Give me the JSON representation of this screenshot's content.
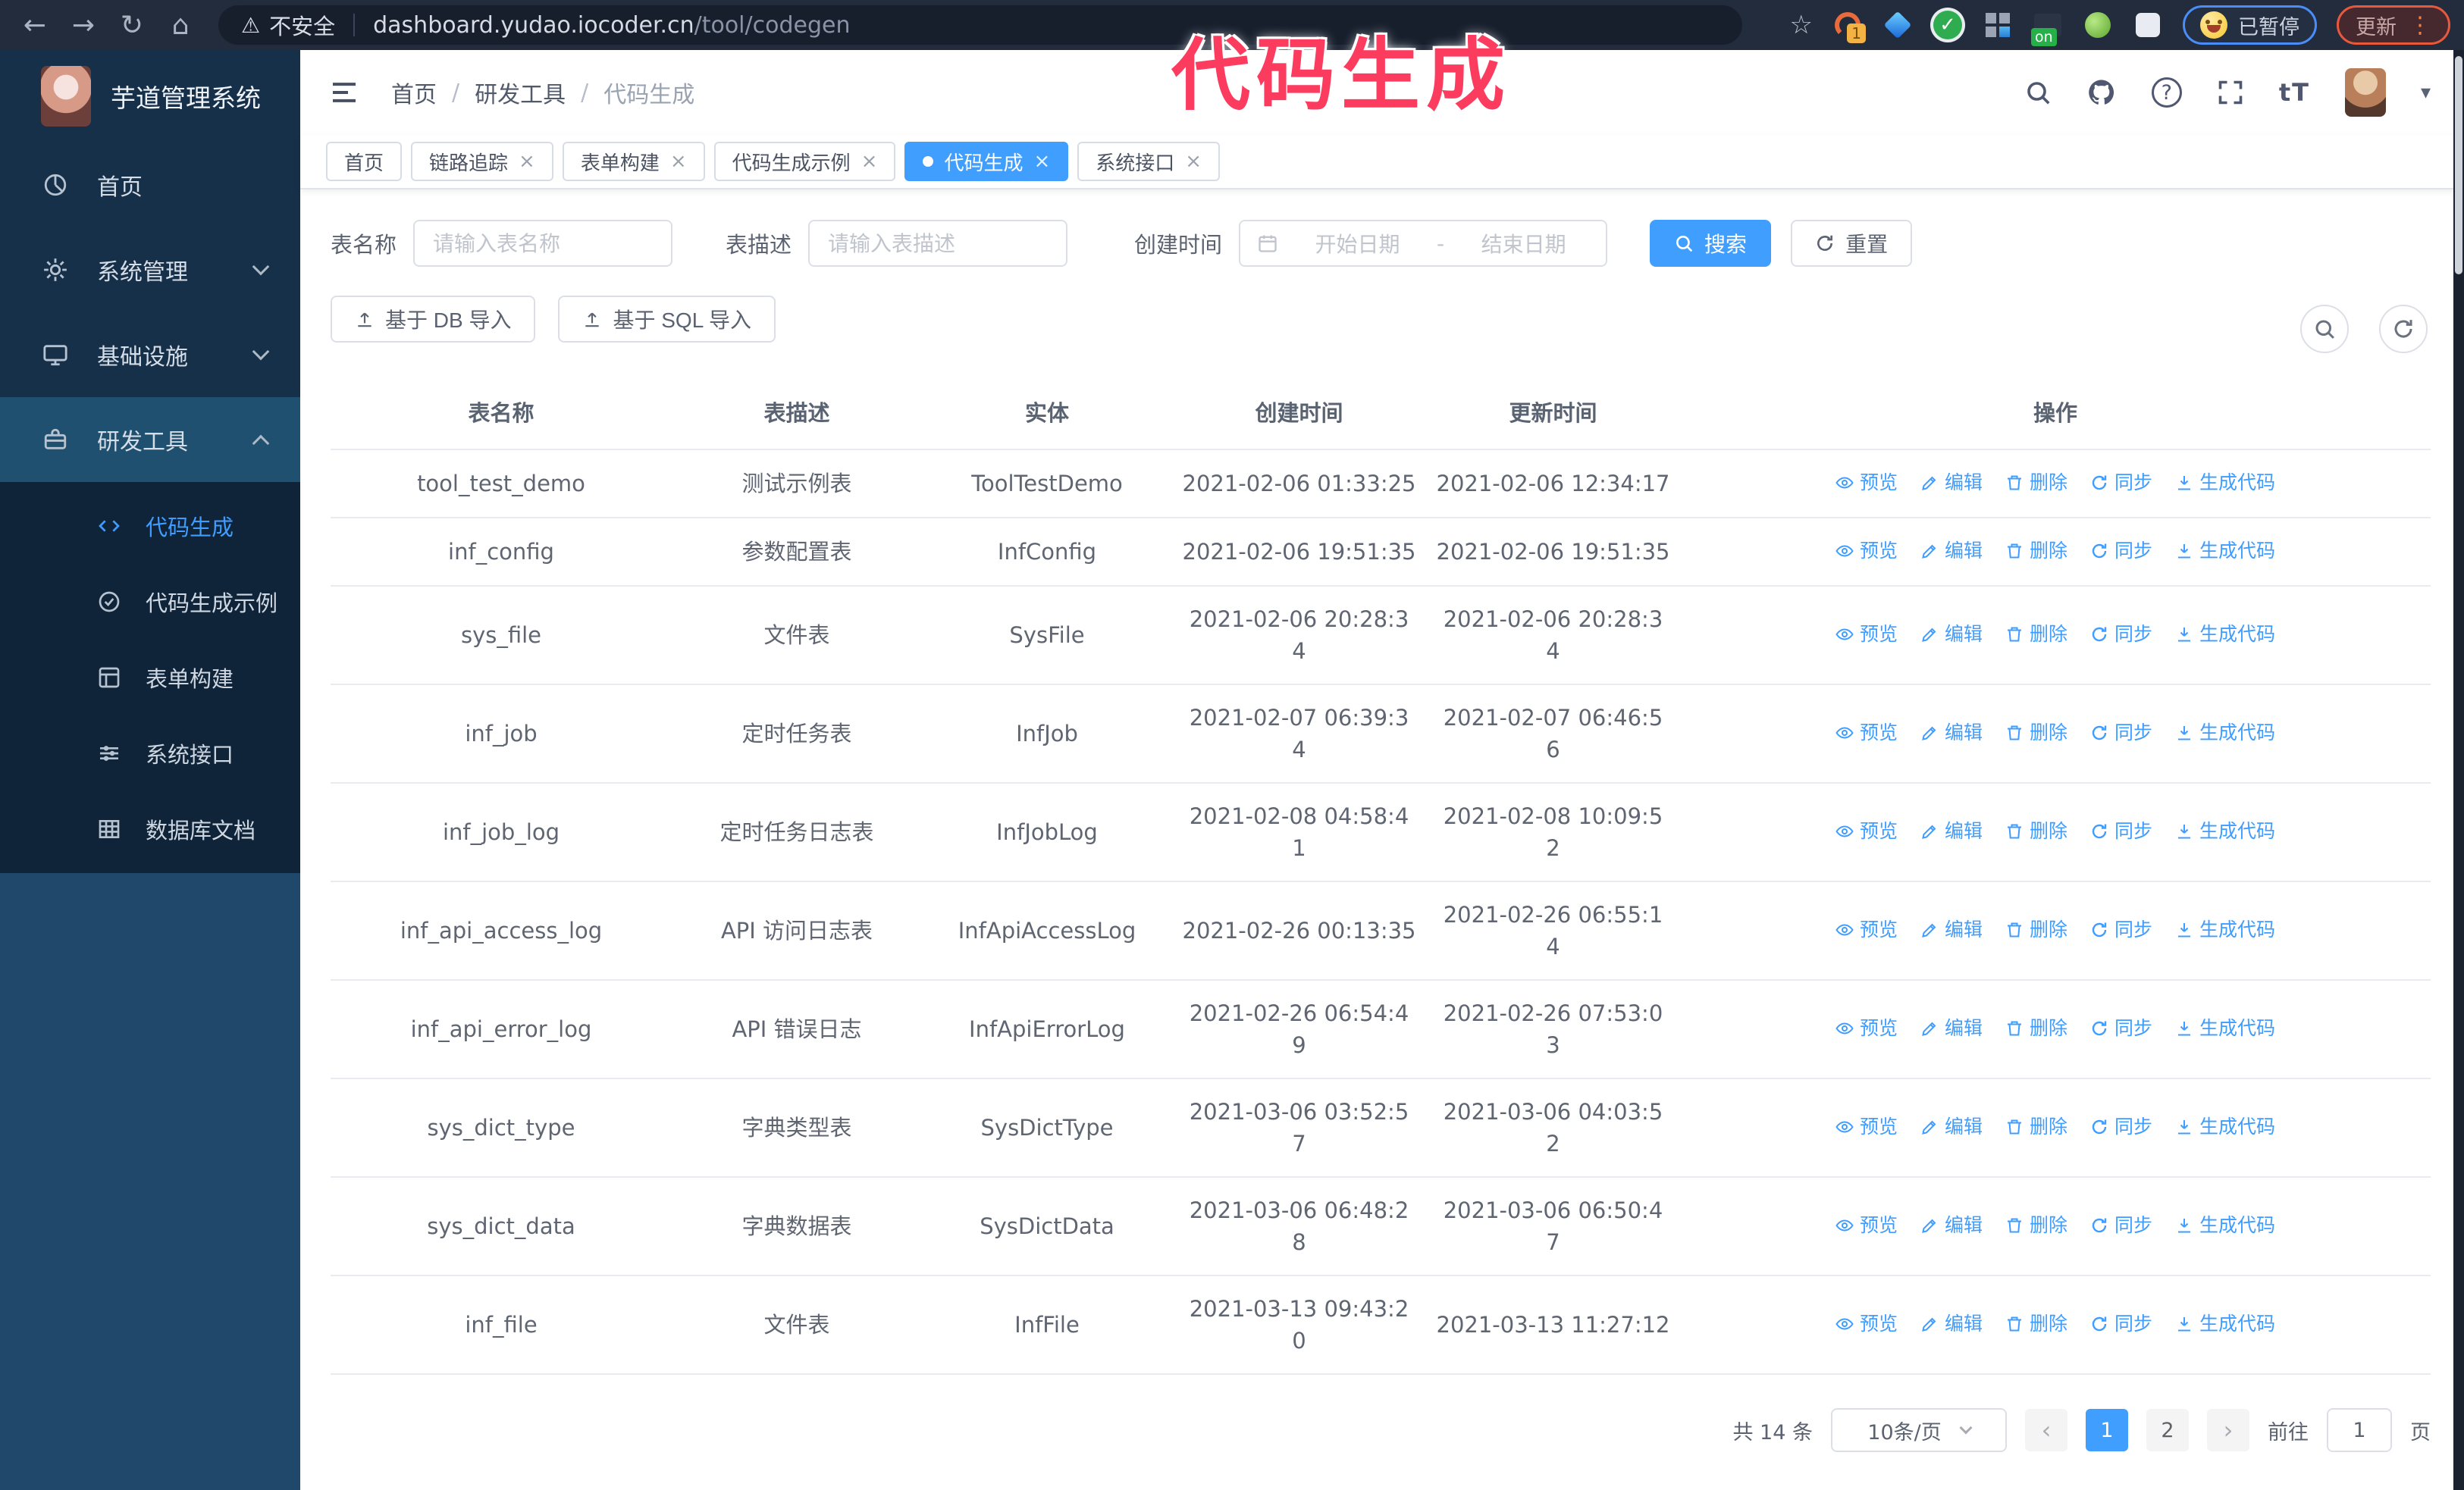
{
  "colors": {
    "accent": "#409eff",
    "annotation_pink": "#fb3c5f",
    "sidebar_bg": "#16304a",
    "submenu_bg": "#0f2438"
  },
  "icons": {
    "back": "←",
    "forward": "→",
    "reload": "↻",
    "home": "⌂",
    "warning": "⚠",
    "star": "☆",
    "check": "✓",
    "kebab": "⋮",
    "close": "×",
    "caret_down": "▾",
    "question": "?",
    "font_size": "tT",
    "prev": "‹",
    "next": "›"
  },
  "browser": {
    "security_label": "不安全",
    "url_domain": "dashboard.yudao.iocoder.cn",
    "url_path": "/tool/codegen",
    "ext_badge_1": "1",
    "ext_on_badge": "on",
    "paused_label": "已暂停",
    "update_label": "更新"
  },
  "annotation": {
    "text": "代码生成"
  },
  "sidebar": {
    "app_title": "芋道管理系统",
    "items": [
      {
        "label": "首页"
      },
      {
        "label": "系统管理"
      },
      {
        "label": "基础设施"
      },
      {
        "label": "研发工具"
      }
    ],
    "submenu": [
      {
        "label": "代码生成"
      },
      {
        "label": "代码生成示例"
      },
      {
        "label": "表单构建"
      },
      {
        "label": "系统接口"
      },
      {
        "label": "数据库文档"
      }
    ]
  },
  "header": {
    "breadcrumb": [
      "首页",
      "研发工具",
      "代码生成"
    ],
    "separator": "/"
  },
  "tabs": [
    {
      "label": "首页"
    },
    {
      "label": "链路追踪"
    },
    {
      "label": "表单构建"
    },
    {
      "label": "代码生成示例"
    },
    {
      "label": "代码生成"
    },
    {
      "label": "系统接口"
    }
  ],
  "filters": {
    "table_name_label": "表名称",
    "table_name_placeholder": "请输入表名称",
    "table_desc_label": "表描述",
    "table_desc_placeholder": "请输入表描述",
    "create_time_label": "创建时间",
    "date_start_placeholder": "开始日期",
    "date_separator": "-",
    "date_end_placeholder": "结束日期",
    "search_label": "搜索",
    "reset_label": "重置"
  },
  "toolbar": {
    "import_db_label": "基于 DB 导入",
    "import_sql_label": "基于 SQL 导入"
  },
  "table": {
    "columns": [
      "表名称",
      "表描述",
      "实体",
      "创建时间",
      "更新时间",
      "操作"
    ],
    "actions": [
      {
        "label": "预览"
      },
      {
        "label": "编辑"
      },
      {
        "label": "删除"
      },
      {
        "label": "同步"
      },
      {
        "label": "生成代码"
      }
    ],
    "rows": [
      {
        "name": "tool_test_demo",
        "desc": "测试示例表",
        "entity": "ToolTestDemo",
        "created": "2021-02-06 01:33:25",
        "updated": "2021-02-06 12:34:17"
      },
      {
        "name": "inf_config",
        "desc": "参数配置表",
        "entity": "InfConfig",
        "created": "2021-02-06 19:51:35",
        "updated": "2021-02-06 19:51:35"
      },
      {
        "name": "sys_file",
        "desc": "文件表",
        "entity": "SysFile",
        "created": "2021-02-06 20:28:3\n4",
        "updated": "2021-02-06 20:28:3\n4"
      },
      {
        "name": "inf_job",
        "desc": "定时任务表",
        "entity": "InfJob",
        "created": "2021-02-07 06:39:3\n4",
        "updated": "2021-02-07 06:46:5\n6"
      },
      {
        "name": "inf_job_log",
        "desc": "定时任务日志表",
        "entity": "InfJobLog",
        "created": "2021-02-08 04:58:4\n1",
        "updated": "2021-02-08 10:09:5\n2"
      },
      {
        "name": "inf_api_access_log",
        "desc": "API 访问日志表",
        "entity": "InfApiAccessLog",
        "created": "2021-02-26 00:13:35",
        "updated": "2021-02-26 06:55:1\n4"
      },
      {
        "name": "inf_api_error_log",
        "desc": "API 错误日志",
        "entity": "InfApiErrorLog",
        "created": "2021-02-26 06:54:4\n9",
        "updated": "2021-02-26 07:53:0\n3"
      },
      {
        "name": "sys_dict_type",
        "desc": "字典类型表",
        "entity": "SysDictType",
        "created": "2021-03-06 03:52:5\n7",
        "updated": "2021-03-06 04:03:5\n2"
      },
      {
        "name": "sys_dict_data",
        "desc": "字典数据表",
        "entity": "SysDictData",
        "created": "2021-03-06 06:48:2\n8",
        "updated": "2021-03-06 06:50:4\n7"
      },
      {
        "name": "inf_file",
        "desc": "文件表",
        "entity": "InfFile",
        "created": "2021-03-13 09:43:2\n0",
        "updated": "2021-03-13 11:27:12"
      }
    ]
  },
  "pagination": {
    "total_label": "共 14 条",
    "page_size_label": "10条/页",
    "pages": [
      "1",
      "2"
    ],
    "goto_label": "前往",
    "goto_value": "1",
    "goto_suffix": "页"
  }
}
